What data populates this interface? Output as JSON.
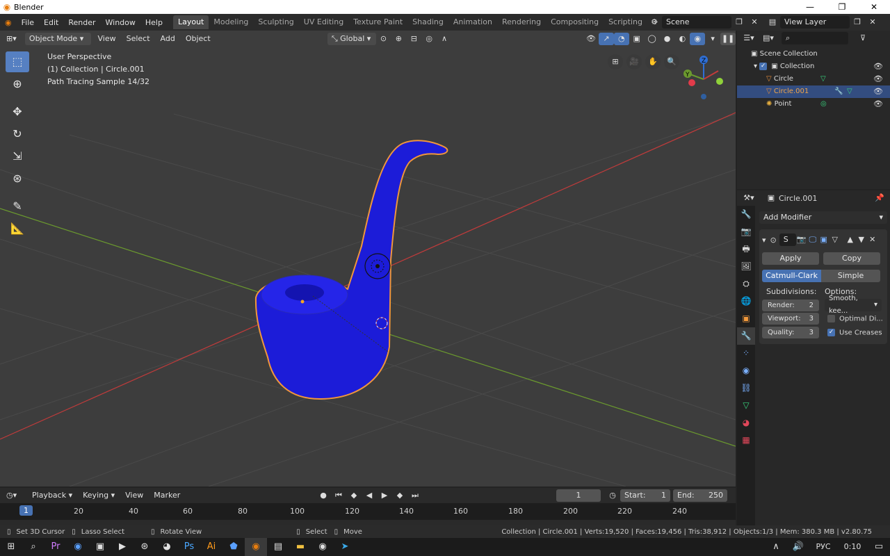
{
  "window": {
    "title": "Blender"
  },
  "menu": [
    "File",
    "Edit",
    "Render",
    "Window",
    "Help"
  ],
  "workspaces": [
    "Layout",
    "Modeling",
    "Sculpting",
    "UV Editing",
    "Texture Paint",
    "Shading",
    "Animation",
    "Rendering",
    "Compositing",
    "Scripting"
  ],
  "scene": {
    "name": "Scene",
    "view_layer": "View Layer"
  },
  "viewport": {
    "mode": "Object Mode",
    "menus": [
      "View",
      "Select",
      "Add",
      "Object"
    ],
    "orientation": "Global",
    "info": [
      "User Perspective",
      "(1) Collection | Circle.001",
      "Path Tracing Sample 14/32"
    ],
    "gizmo": {
      "z": "Z",
      "y": "Y"
    }
  },
  "outliner": {
    "root": "Scene Collection",
    "collection": "Collection",
    "items": [
      "Circle",
      "Circle.001",
      "Point"
    ]
  },
  "properties": {
    "object": "Circle.001",
    "add_modifier": "Add Modifier",
    "modifier_name": "S",
    "apply": "Apply",
    "copy": "Copy",
    "type_active": "Catmull-Clark",
    "type_other": "Simple",
    "subdivisions_label": "Subdivisions:",
    "options_label": "Options:",
    "render_label": "Render:",
    "render_value": "2",
    "viewport_label": "Viewport:",
    "viewport_value": "3",
    "quality_label": "Quality:",
    "quality_value": "3",
    "uv_option": "Smooth, kee...",
    "optimal_display": "Optimal Di...",
    "use_creases": "Use Creases"
  },
  "timeline": {
    "menus": [
      "Playback",
      "Keying",
      "View",
      "Marker"
    ],
    "current_frame": "1",
    "start_label": "Start:",
    "start": "1",
    "end_label": "End:",
    "end": "250",
    "ticks": [
      "1",
      "20",
      "40",
      "60",
      "80",
      "100",
      "120",
      "140",
      "160",
      "180",
      "200",
      "220",
      "240"
    ]
  },
  "statusbar": {
    "left": [
      "Set 3D Cursor",
      "Lasso Select",
      "Rotate View"
    ],
    "middle": [
      "Select",
      "Move"
    ],
    "right": "Collection | Circle.001 | Verts:19,520 | Faces:19,456 | Tris:38,912 | Objects:1/3 | Mem: 380.3 MB | v2.80.75"
  },
  "taskbar": {
    "lang": "РУС",
    "time": "0:10"
  },
  "colors": {
    "accent": "#4772b3",
    "object_blue": "#1a1ae6",
    "selection_orange": "#f0963c",
    "x_axis": "#c23b3b",
    "y_axis": "#6b9a2e"
  }
}
